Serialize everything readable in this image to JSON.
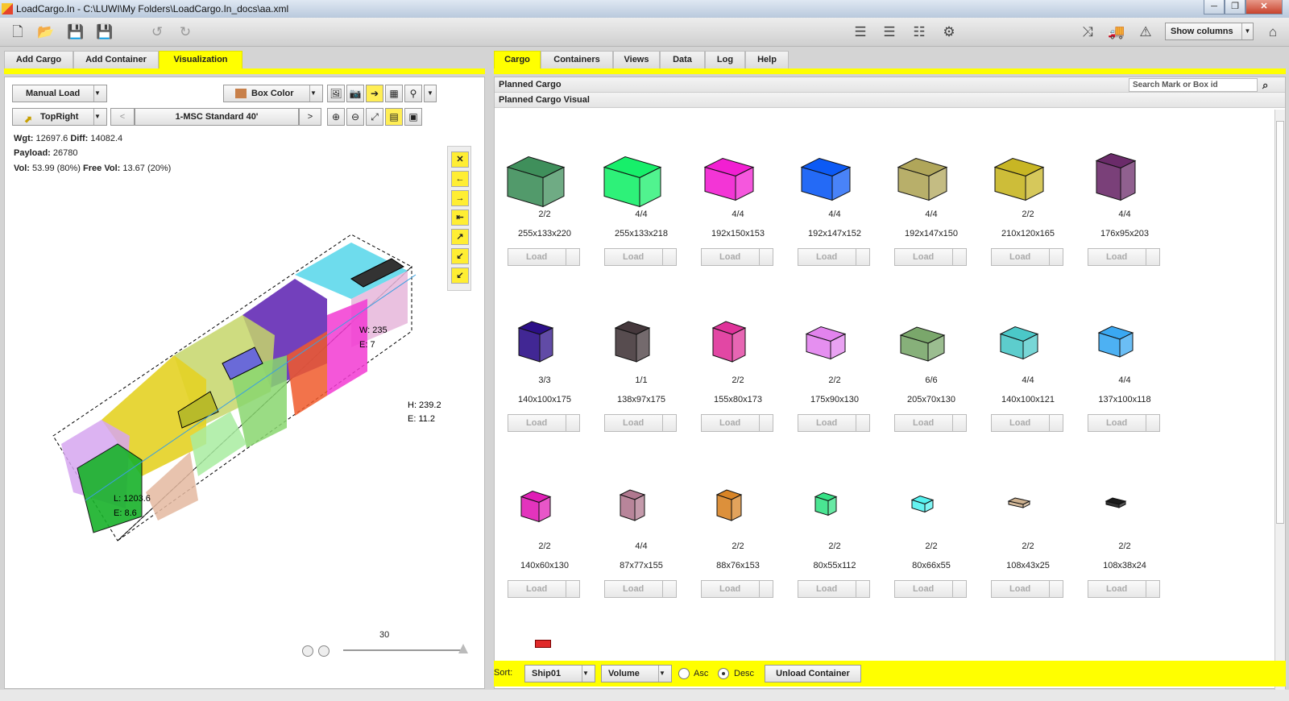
{
  "window": {
    "title": "LoadCargo.In - C:\\LUWI\\My Folders\\LoadCargo.In_docs\\aa.xml"
  },
  "toolbar": {
    "show_columns": "Show columns",
    "icons": [
      "new-doc",
      "open-folder",
      "save",
      "save-as",
      "undo",
      "redo",
      "list-left",
      "list-center",
      "list",
      "settings-x",
      "shuffle",
      "truck",
      "warning",
      "home"
    ]
  },
  "left_tabs": [
    "Add Cargo",
    "Add Container",
    "Visualization"
  ],
  "right_tabs": [
    "Cargo",
    "Containers",
    "Views",
    "Data",
    "Log",
    "Help"
  ],
  "viz": {
    "load_mode": "Manual Load",
    "color_mode": "Box Color",
    "orientation": "TopRight",
    "prev": "<",
    "container": "1-MSC Standard 40'",
    "next": ">",
    "wgt_label": "Wgt:",
    "wgt": "12697.6",
    "diff_label": "Diff:",
    "diff": "14082.4",
    "payload_label": "Payload:",
    "payload": "26780",
    "vol_label": "Vol:",
    "vol": "53.99 (80%)",
    "free_label": "Free Vol:",
    "free": "13.67 (20%)",
    "w_label": "W: 235",
    "e1_label": "E: 7",
    "h_label": "H: 239.2",
    "e2_label": "E: 11.2",
    "l_label": "L: 1203.6",
    "e3_label": "E: 8.6",
    "slider_value": "30"
  },
  "cargo": {
    "planned_header": "Planned Cargo",
    "visual_header": "Planned Cargo Visual",
    "search_placeholder": "Search Mark or Box id",
    "load_label": "Load",
    "items": [
      {
        "count": "2/2",
        "dims": "255x133x220",
        "color": "#3f8f5b"
      },
      {
        "count": "4/4",
        "dims": "255x133x218",
        "color": "#17ef6a"
      },
      {
        "count": "4/4",
        "dims": "192x150x153",
        "color": "#f21fd2"
      },
      {
        "count": "4/4",
        "dims": "192x147x152",
        "color": "#0c5af5"
      },
      {
        "count": "4/4",
        "dims": "192x147x150",
        "color": "#b0a65a"
      },
      {
        "count": "2/2",
        "dims": "210x120x165",
        "color": "#c8b624"
      },
      {
        "count": "4/4",
        "dims": "176x95x203",
        "color": "#6b2b6a"
      },
      {
        "count": "3/3",
        "dims": "140x100x175",
        "color": "#2c0f88"
      },
      {
        "count": "1/1",
        "dims": "138x97x175",
        "color": "#45383c"
      },
      {
        "count": "2/2",
        "dims": "155x80x173",
        "color": "#df339a"
      },
      {
        "count": "2/2",
        "dims": "175x90x130",
        "color": "#e283ee"
      },
      {
        "count": "6/6",
        "dims": "205x70x130",
        "color": "#7aa76b"
      },
      {
        "count": "4/4",
        "dims": "140x100x121",
        "color": "#4bc8c8"
      },
      {
        "count": "4/4",
        "dims": "137x100x118",
        "color": "#3aa8f2"
      },
      {
        "count": "2/2",
        "dims": "140x60x130",
        "color": "#e01eb6"
      },
      {
        "count": "4/4",
        "dims": "87x77x155",
        "color": "#b0788f"
      },
      {
        "count": "2/2",
        "dims": "88x76x153",
        "color": "#d88426"
      },
      {
        "count": "2/2",
        "dims": "80x55x112",
        "color": "#36e286"
      },
      {
        "count": "2/2",
        "dims": "80x66x55",
        "color": "#54f2f0"
      },
      {
        "count": "2/2",
        "dims": "108x43x25",
        "color": "#cdb08e"
      },
      {
        "count": "2/2",
        "dims": "108x38x24",
        "color": "#1b1b1b"
      }
    ]
  },
  "bottom": {
    "sort_label": "Sort:",
    "ship": "Ship01",
    "volume": "Volume",
    "asc": "Asc",
    "desc": "Desc",
    "unload": "Unload Container"
  }
}
